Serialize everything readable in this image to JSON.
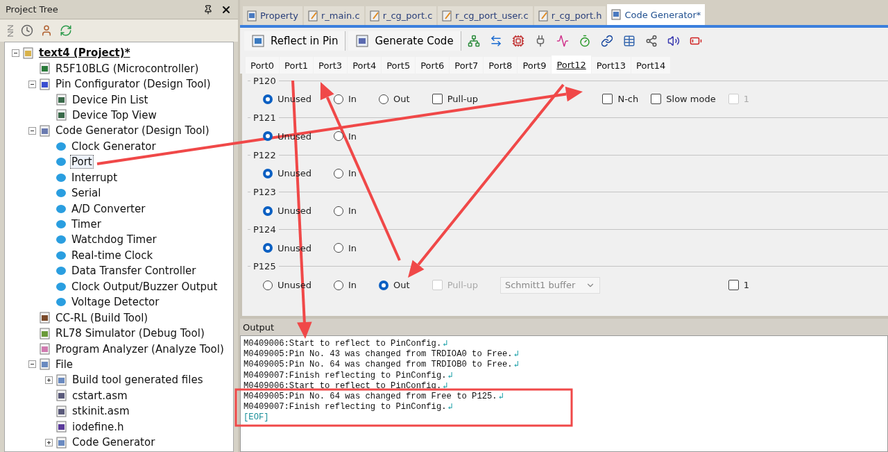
{
  "project_panel": {
    "title": "Project Tree",
    "tree": [
      {
        "label": "text4 (Project)*",
        "kind": "project",
        "expanded": true,
        "selected": false,
        "children": [
          {
            "label": "R5F10BLG (Microcontroller)",
            "kind": "chip",
            "selected": false
          },
          {
            "label": "Pin Configurator (Design Tool)",
            "kind": "pin",
            "expanded": true,
            "selected": false,
            "children": [
              {
                "label": "Device Pin List",
                "kind": "board",
                "selected": false
              },
              {
                "label": "Device Top View",
                "kind": "board",
                "selected": false
              }
            ]
          },
          {
            "label": "Code Generator (Design Tool)",
            "kind": "generator",
            "expanded": true,
            "selected": false,
            "children": [
              {
                "label": "Clock Generator",
                "kind": "component",
                "selected": false
              },
              {
                "label": "Port",
                "kind": "component",
                "selected": true
              },
              {
                "label": "Interrupt",
                "kind": "component",
                "selected": false
              },
              {
                "label": "Serial",
                "kind": "component",
                "selected": false
              },
              {
                "label": "A/D Converter",
                "kind": "component",
                "selected": false
              },
              {
                "label": "Timer",
                "kind": "component",
                "selected": false
              },
              {
                "label": "Watchdog Timer",
                "kind": "component",
                "selected": false
              },
              {
                "label": "Real-time Clock",
                "kind": "component",
                "selected": false
              },
              {
                "label": "Data Transfer Controller",
                "kind": "component",
                "selected": false
              },
              {
                "label": "Clock Output/Buzzer Output",
                "kind": "component",
                "selected": false
              },
              {
                "label": "Voltage Detector",
                "kind": "component",
                "selected": false
              }
            ]
          },
          {
            "label": "CC-RL (Build Tool)",
            "kind": "hammer",
            "selected": false
          },
          {
            "label": "RL78 Simulator (Debug Tool)",
            "kind": "debug",
            "selected": false
          },
          {
            "label": "Program Analyzer (Analyze Tool)",
            "kind": "analyzer",
            "selected": false
          },
          {
            "label": "File",
            "kind": "folder",
            "expanded": true,
            "selected": false,
            "children": [
              {
                "label": "Build tool generated files",
                "kind": "folder",
                "expanded": false,
                "selected": false
              },
              {
                "label": "cstart.asm",
                "kind": "asm",
                "selected": false
              },
              {
                "label": "stkinit.asm",
                "kind": "asm",
                "selected": false
              },
              {
                "label": "iodefine.h",
                "kind": "header",
                "selected": false
              },
              {
                "label": "Code Generator",
                "kind": "folder",
                "expanded": false,
                "selected": false
              }
            ]
          }
        ]
      }
    ]
  },
  "document_tabs": [
    {
      "label": "Property",
      "kind": "property",
      "selected": false
    },
    {
      "label": "r_main.c",
      "kind": "source",
      "selected": false
    },
    {
      "label": "r_cg_port.c",
      "kind": "source",
      "selected": false
    },
    {
      "label": "r_cg_port_user.c",
      "kind": "source",
      "selected": false
    },
    {
      "label": "r_cg_port.h",
      "kind": "source",
      "selected": false
    },
    {
      "label": "Code Generator*",
      "kind": "generator",
      "selected": true
    }
  ],
  "toolbar": {
    "buttons": [
      {
        "label": "Reflect in Pin",
        "kind": "reflect"
      },
      {
        "label": "Generate Code",
        "kind": "generate"
      }
    ]
  },
  "port_tabs": [
    {
      "label": "Port0",
      "selected": false
    },
    {
      "label": "Port1",
      "selected": false
    },
    {
      "label": "Port3",
      "selected": false
    },
    {
      "label": "Port4",
      "selected": false
    },
    {
      "label": "Port5",
      "selected": false
    },
    {
      "label": "Port6",
      "selected": false
    },
    {
      "label": "Port7",
      "selected": false
    },
    {
      "label": "Port8",
      "selected": false
    },
    {
      "label": "Port9",
      "selected": false
    },
    {
      "label": "Port12",
      "selected": true
    },
    {
      "label": "Port13",
      "selected": false
    },
    {
      "label": "Port14",
      "selected": false
    }
  ],
  "pins": [
    {
      "name": "P120",
      "controls": [
        {
          "kind": "radio",
          "label": "Unused",
          "selected": true
        },
        {
          "kind": "radio",
          "label": "In",
          "selected": false
        },
        {
          "kind": "radio",
          "label": "Out",
          "selected": false
        },
        {
          "kind": "checkbox",
          "label": "Pull-up",
          "checked": false,
          "disabled": false
        }
      ],
      "right_controls": [
        {
          "kind": "checkbox",
          "label": "N-ch",
          "checked": false,
          "disabled": false
        },
        {
          "kind": "checkbox",
          "label": "Slow mode",
          "checked": false,
          "disabled": false
        },
        {
          "kind": "checkbox",
          "label": "1",
          "checked": false,
          "disabled": true
        }
      ]
    },
    {
      "name": "P121",
      "controls": [
        {
          "kind": "radio",
          "label": "Unused",
          "selected": true
        },
        {
          "kind": "radio",
          "label": "In",
          "selected": false
        }
      ]
    },
    {
      "name": "P122",
      "controls": [
        {
          "kind": "radio",
          "label": "Unused",
          "selected": true
        },
        {
          "kind": "radio",
          "label": "In",
          "selected": false
        }
      ]
    },
    {
      "name": "P123",
      "controls": [
        {
          "kind": "radio",
          "label": "Unused",
          "selected": true
        },
        {
          "kind": "radio",
          "label": "In",
          "selected": false
        }
      ]
    },
    {
      "name": "P124",
      "controls": [
        {
          "kind": "radio",
          "label": "Unused",
          "selected": true
        },
        {
          "kind": "radio",
          "label": "In",
          "selected": false
        }
      ]
    },
    {
      "name": "P125",
      "controls": [
        {
          "kind": "radio",
          "label": "Unused",
          "selected": false
        },
        {
          "kind": "radio",
          "label": "In",
          "selected": false
        },
        {
          "kind": "radio",
          "label": "Out",
          "selected": true
        },
        {
          "kind": "checkbox",
          "label": "Pull-up",
          "checked": false,
          "disabled": true
        },
        {
          "kind": "select",
          "value": "Schmitt1 buffer",
          "disabled": true
        }
      ],
      "right_controls": [
        {
          "kind": "checkbox",
          "label": "1",
          "checked": false,
          "disabled": false
        }
      ]
    }
  ],
  "output": {
    "title": "Output",
    "lines": [
      {
        "kind": "message",
        "text": "M0409006:Start to reflect to PinConfig.",
        "mark": "↲"
      },
      {
        "kind": "message",
        "text": "M0409005:Pin No. 43 was changed from TRDIOA0 to Free.",
        "mark": "↲"
      },
      {
        "kind": "message",
        "text": "M0409005:Pin No. 64 was changed from TRDIOB0 to Free.",
        "mark": "↲"
      },
      {
        "kind": "message",
        "text": "M0409007:Finish reflecting to PinConfig.",
        "mark": "↲"
      },
      {
        "kind": "message",
        "text": "M0409006:Start to reflect to PinConfig.",
        "mark": "↲"
      },
      {
        "kind": "message",
        "text": "M0409005:Pin No. 64 was changed from Free to P125.",
        "mark": "↲"
      },
      {
        "kind": "message",
        "text": "M0409007:Finish reflecting to PinConfig.",
        "mark": "↲"
      },
      {
        "kind": "eof",
        "text": "[EOF]"
      }
    ]
  }
}
